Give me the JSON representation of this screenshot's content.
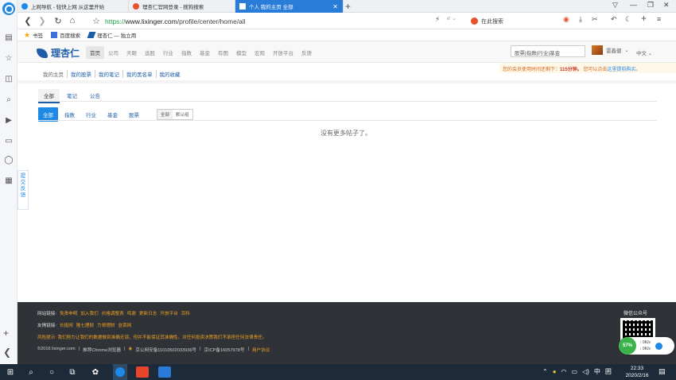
{
  "browser": {
    "tabs": [
      {
        "label": "上网导航 - 轻快上网 从这里开始"
      },
      {
        "label": "理杏仁官网登录 - 搜狗搜索"
      },
      {
        "label": "个人 我的主页 全部",
        "active": true
      }
    ],
    "url_protocol": "https://",
    "url_host": "www.lixinger.com",
    "url_path": "/profile/center/home/all",
    "search_placeholder": "在此搜索",
    "bookmarks": [
      "书签",
      "百度搜索",
      "理杏仁 — 独立用"
    ]
  },
  "site": {
    "logo": "理杏仁",
    "nav": [
      "首页",
      "公司",
      "天眼",
      "选股",
      "行业",
      "指数",
      "基金",
      "有图",
      "模型",
      "宏观",
      "开放平台",
      "反馈"
    ],
    "search_value": "股票|指数|行业|基金",
    "user_name": "雷鑫健",
    "lang": "中文",
    "notice_prefix": "您的会员使用时间还剩下：",
    "notice_time": "115分钟。",
    "notice_suffix": "您可以点击",
    "notice_link": "这里提前购买。"
  },
  "profile": {
    "subnav": [
      "我的主页",
      "我的股票",
      "我的笔记",
      "我的黑名单",
      "我的收藏"
    ],
    "type_tabs": [
      "全部",
      "笔记",
      "公告"
    ],
    "filters": [
      "全部",
      "指数",
      "行业",
      "基金",
      "股票"
    ],
    "segment": [
      "全部",
      "默认组"
    ],
    "empty_text": "没有更多帖子了。"
  },
  "sidebar": {
    "feedback_label": "提交反馈"
  },
  "footer": {
    "links_label": "网站链接:",
    "links": [
      "免责申明",
      "加入我们",
      "价格调整表",
      "鸣谢",
      "更新日志",
      "开放平台",
      "百科"
    ],
    "friends_label": "友情链接:",
    "friends": [
      "长投网",
      "隆七理财",
      "力哥理财",
      "韭菜网"
    ],
    "risk_text": "风险提示: 我们努力让我们的数据做到准确无误。但并不能保证其准确性。对任何投资决策我们不承担任何法律责任。",
    "copyright": "©2016 lixinger.com",
    "copy_mid": "推荐Chrome浏览器",
    "police": "京公网安备11010502033936号",
    "icp": "京ICP备16057978号",
    "agreement": "用户协议",
    "wechat_label": "微信公众号",
    "speed_pct": "57%",
    "speed_up": "0K/s",
    "speed_down": "0K/s"
  },
  "taskbar": {
    "ime": "中",
    "ime2": "囲",
    "time": "22:33",
    "date": "2020/2/16"
  }
}
